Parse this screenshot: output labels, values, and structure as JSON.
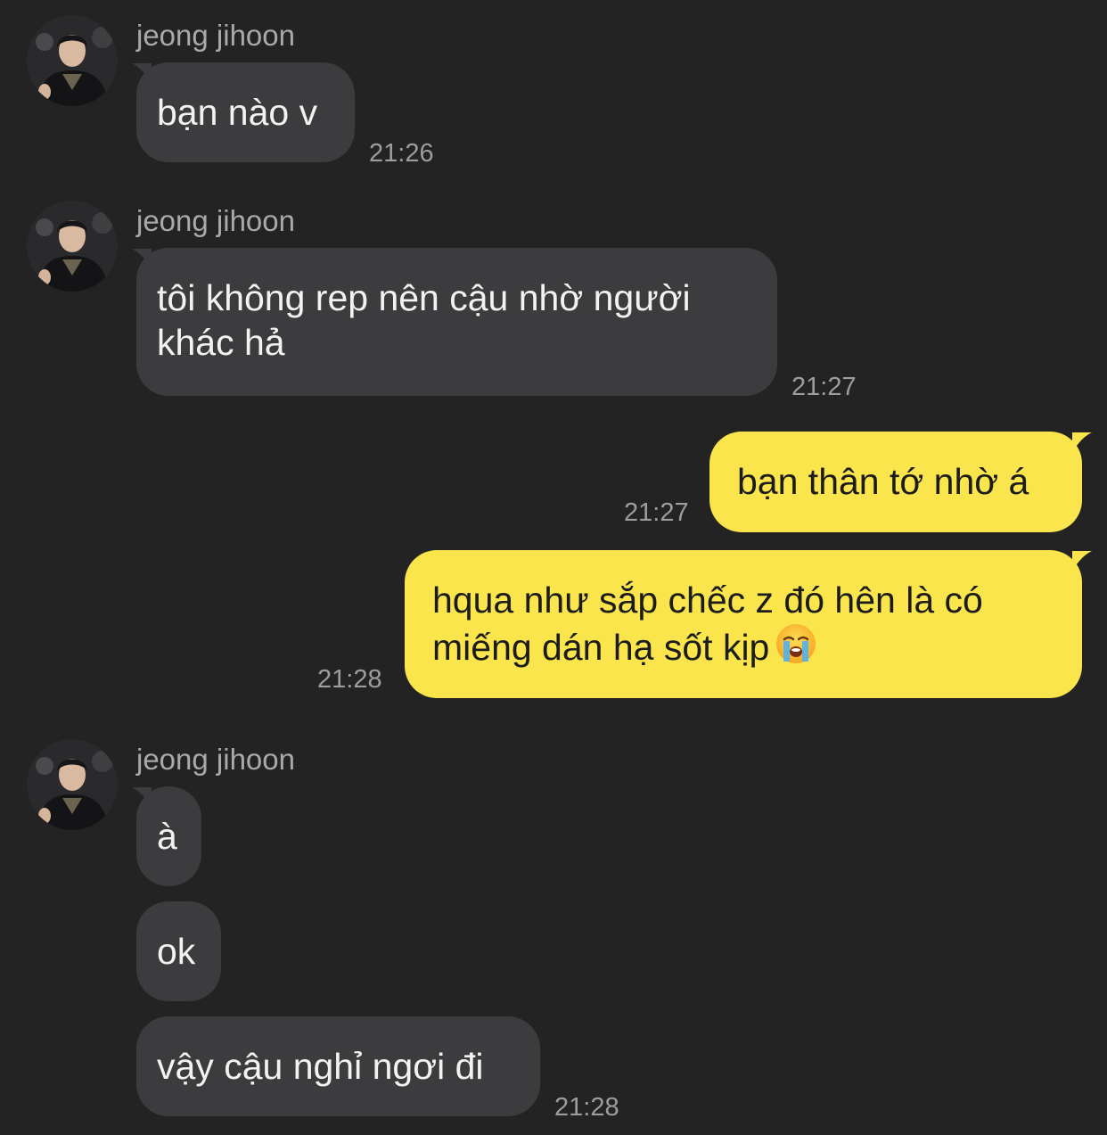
{
  "sender": {
    "name": "jeong jihoon"
  },
  "messages": [
    {
      "id": "m1",
      "side": "in",
      "lines": [
        "bạn nào v"
      ],
      "time": "21:26"
    },
    {
      "id": "m2",
      "side": "in",
      "lines": [
        "tôi không rep nên cậu nhờ người",
        "khác hả"
      ],
      "time": "21:27"
    },
    {
      "id": "m3",
      "side": "out",
      "lines": [
        "bạn thân tớ nhờ á"
      ],
      "time": "21:27"
    },
    {
      "id": "m4",
      "side": "out",
      "lines": [
        "hqua như sắp chếc z đó hên là có",
        "miếng dán hạ sốt kịp"
      ],
      "emoji": "loudly-crying-face-emoji",
      "time": "21:28"
    },
    {
      "id": "m5",
      "side": "in",
      "lines": [
        "à"
      ]
    },
    {
      "id": "m6",
      "side": "in",
      "lines": [
        "ok"
      ]
    },
    {
      "id": "m7",
      "side": "in",
      "lines": [
        "vậy cậu nghỉ ngơi đi"
      ],
      "time": "21:28"
    }
  ],
  "colors": {
    "background": "#232324",
    "incoming_bubble": "#3c3c3e",
    "outgoing_bubble": "#fae54c",
    "timestamp": "#9d9d9f",
    "sender_name": "#a9a9ab"
  }
}
